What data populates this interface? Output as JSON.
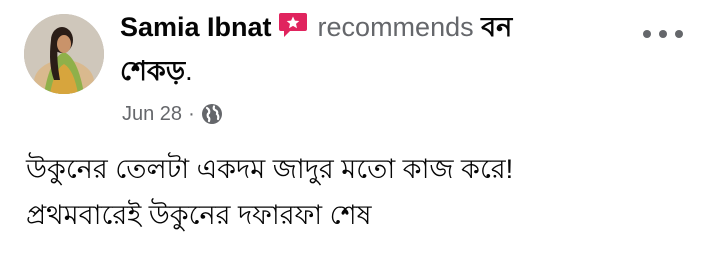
{
  "post": {
    "author": "Samia Ibnat",
    "verb": "recommends",
    "page_name_part1": "বন",
    "page_name_part2": "শেকড়",
    "page_name_end": ".",
    "date": "Jun 28",
    "separator": "·",
    "audience_icon": "globe-icon",
    "recommend_icon": "recommend-star-icon",
    "more_icon": "more-options-icon",
    "body_lines": [
      "উকুনের তেলটা একদম জাদুর মতো কাজ করে!",
      "প্রথমবারেই উকুনের দফারফা শেষ"
    ]
  },
  "colors": {
    "text_primary": "#050505",
    "text_secondary": "#65676b",
    "recommend_icon": "#e0245e",
    "background": "#ffffff"
  }
}
